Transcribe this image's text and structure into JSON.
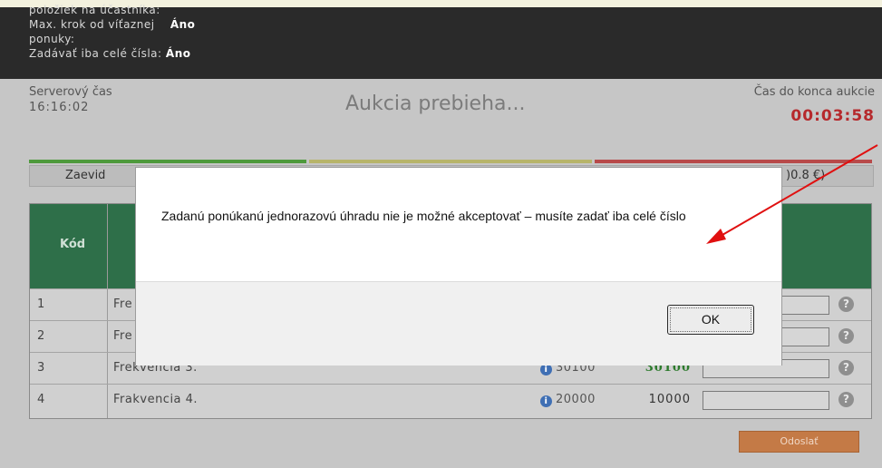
{
  "header": {
    "line_cut": "položiek na účastníka:",
    "max_step_label": "Max. krok od víťaznej",
    "max_step_label2": "ponuky:",
    "max_step_value": "Áno",
    "integers_label": "Zadávať iba celé čísla:",
    "integers_value": "Áno"
  },
  "status_bar": {
    "server_time_label": "Serverový čas",
    "server_time": "16:16:02",
    "auction_status": "Aukcia prebieha...",
    "countdown_label": "Čas do konca aukcie",
    "countdown": "00:03:58"
  },
  "info_row": {
    "left_text": "Zaevid",
    "right_text": ")0.8 €)"
  },
  "table": {
    "code_header": "Kód",
    "rows": [
      {
        "num": "1",
        "name": "Fre",
        "value": "",
        "current": ""
      },
      {
        "num": "2",
        "name": "Fre",
        "value": "",
        "current": ""
      },
      {
        "num": "3",
        "name": "Frekvencia 3.",
        "value": "30100",
        "current": "30100"
      },
      {
        "num": "4",
        "name": "Frakvencia 4.",
        "value": "20000",
        "current": "10000"
      }
    ]
  },
  "submit_label": "Odoslať",
  "dialog": {
    "message": "Zadanú ponúkanú jednorazovú úhradu nie je možné akceptovať – musíte zadať iba celé číslo",
    "ok_label": "OK"
  },
  "colors": {
    "bar_green": "#4e9a3c",
    "bar_olive": "#b7b46a",
    "bar_red": "#b84a4a",
    "annotation_arrow": "#e01010"
  },
  "icons": {
    "info": "info-icon",
    "help": "help-icon"
  }
}
